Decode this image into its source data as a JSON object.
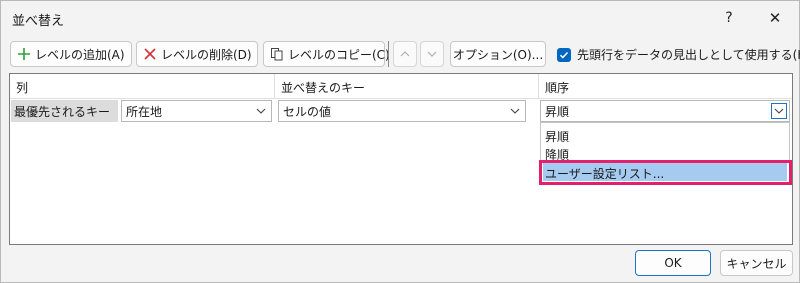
{
  "dialog": {
    "title": "並べ替え",
    "help_glyph": "?",
    "close_glyph": "✕"
  },
  "toolbar": {
    "add_label": "レベルの追加(A)",
    "delete_label": "レベルの削除(D)",
    "copy_label": "レベルのコピー(C)",
    "options_label": "オプション(O)...",
    "header_checkbox_label": "先頭行をデータの見出しとして使用する(H)",
    "header_checkbox_checked": true
  },
  "grid": {
    "headers": [
      "列",
      "並べ替えのキー",
      "順序"
    ],
    "row": {
      "label": "最優先されるキー",
      "column_value": "所在地",
      "key_value": "セルの値",
      "order_value": "昇順"
    },
    "order_options": [
      "昇順",
      "降順",
      "ユーザー設定リスト..."
    ],
    "highlighted_option_index": 2,
    "highlight_color": "#e2206c",
    "selection_color": "#a6cbf0"
  },
  "footer": {
    "ok_label": "OK",
    "cancel_label": "キャンセル"
  },
  "icons": {
    "add": "plus-icon",
    "delete": "x-icon",
    "copy": "copy-icon",
    "up": "arrow-up-icon",
    "down": "arrow-down-icon",
    "dropdown": "chevron-down-icon"
  },
  "colors": {
    "accent": "#0067c0",
    "add_icon": "#2e9e3e",
    "delete_icon": "#d13438"
  }
}
